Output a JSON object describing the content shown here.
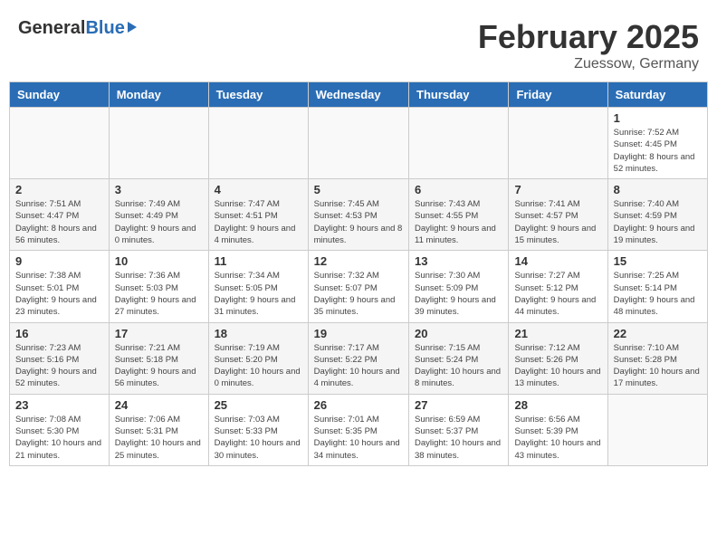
{
  "header": {
    "logo_general": "General",
    "logo_blue": "Blue",
    "month_title": "February 2025",
    "location": "Zuessow, Germany"
  },
  "days_of_week": [
    "Sunday",
    "Monday",
    "Tuesday",
    "Wednesday",
    "Thursday",
    "Friday",
    "Saturday"
  ],
  "weeks": [
    [
      {
        "day": "",
        "empty": true
      },
      {
        "day": "",
        "empty": true
      },
      {
        "day": "",
        "empty": true
      },
      {
        "day": "",
        "empty": true
      },
      {
        "day": "",
        "empty": true
      },
      {
        "day": "",
        "empty": true
      },
      {
        "day": "1",
        "sunrise": "Sunrise: 7:52 AM",
        "sunset": "Sunset: 4:45 PM",
        "daylight": "Daylight: 8 hours and 52 minutes."
      }
    ],
    [
      {
        "day": "2",
        "sunrise": "Sunrise: 7:51 AM",
        "sunset": "Sunset: 4:47 PM",
        "daylight": "Daylight: 8 hours and 56 minutes."
      },
      {
        "day": "3",
        "sunrise": "Sunrise: 7:49 AM",
        "sunset": "Sunset: 4:49 PM",
        "daylight": "Daylight: 9 hours and 0 minutes."
      },
      {
        "day": "4",
        "sunrise": "Sunrise: 7:47 AM",
        "sunset": "Sunset: 4:51 PM",
        "daylight": "Daylight: 9 hours and 4 minutes."
      },
      {
        "day": "5",
        "sunrise": "Sunrise: 7:45 AM",
        "sunset": "Sunset: 4:53 PM",
        "daylight": "Daylight: 9 hours and 8 minutes."
      },
      {
        "day": "6",
        "sunrise": "Sunrise: 7:43 AM",
        "sunset": "Sunset: 4:55 PM",
        "daylight": "Daylight: 9 hours and 11 minutes."
      },
      {
        "day": "7",
        "sunrise": "Sunrise: 7:41 AM",
        "sunset": "Sunset: 4:57 PM",
        "daylight": "Daylight: 9 hours and 15 minutes."
      },
      {
        "day": "8",
        "sunrise": "Sunrise: 7:40 AM",
        "sunset": "Sunset: 4:59 PM",
        "daylight": "Daylight: 9 hours and 19 minutes."
      }
    ],
    [
      {
        "day": "9",
        "sunrise": "Sunrise: 7:38 AM",
        "sunset": "Sunset: 5:01 PM",
        "daylight": "Daylight: 9 hours and 23 minutes."
      },
      {
        "day": "10",
        "sunrise": "Sunrise: 7:36 AM",
        "sunset": "Sunset: 5:03 PM",
        "daylight": "Daylight: 9 hours and 27 minutes."
      },
      {
        "day": "11",
        "sunrise": "Sunrise: 7:34 AM",
        "sunset": "Sunset: 5:05 PM",
        "daylight": "Daylight: 9 hours and 31 minutes."
      },
      {
        "day": "12",
        "sunrise": "Sunrise: 7:32 AM",
        "sunset": "Sunset: 5:07 PM",
        "daylight": "Daylight: 9 hours and 35 minutes."
      },
      {
        "day": "13",
        "sunrise": "Sunrise: 7:30 AM",
        "sunset": "Sunset: 5:09 PM",
        "daylight": "Daylight: 9 hours and 39 minutes."
      },
      {
        "day": "14",
        "sunrise": "Sunrise: 7:27 AM",
        "sunset": "Sunset: 5:12 PM",
        "daylight": "Daylight: 9 hours and 44 minutes."
      },
      {
        "day": "15",
        "sunrise": "Sunrise: 7:25 AM",
        "sunset": "Sunset: 5:14 PM",
        "daylight": "Daylight: 9 hours and 48 minutes."
      }
    ],
    [
      {
        "day": "16",
        "sunrise": "Sunrise: 7:23 AM",
        "sunset": "Sunset: 5:16 PM",
        "daylight": "Daylight: 9 hours and 52 minutes."
      },
      {
        "day": "17",
        "sunrise": "Sunrise: 7:21 AM",
        "sunset": "Sunset: 5:18 PM",
        "daylight": "Daylight: 9 hours and 56 minutes."
      },
      {
        "day": "18",
        "sunrise": "Sunrise: 7:19 AM",
        "sunset": "Sunset: 5:20 PM",
        "daylight": "Daylight: 10 hours and 0 minutes."
      },
      {
        "day": "19",
        "sunrise": "Sunrise: 7:17 AM",
        "sunset": "Sunset: 5:22 PM",
        "daylight": "Daylight: 10 hours and 4 minutes."
      },
      {
        "day": "20",
        "sunrise": "Sunrise: 7:15 AM",
        "sunset": "Sunset: 5:24 PM",
        "daylight": "Daylight: 10 hours and 8 minutes."
      },
      {
        "day": "21",
        "sunrise": "Sunrise: 7:12 AM",
        "sunset": "Sunset: 5:26 PM",
        "daylight": "Daylight: 10 hours and 13 minutes."
      },
      {
        "day": "22",
        "sunrise": "Sunrise: 7:10 AM",
        "sunset": "Sunset: 5:28 PM",
        "daylight": "Daylight: 10 hours and 17 minutes."
      }
    ],
    [
      {
        "day": "23",
        "sunrise": "Sunrise: 7:08 AM",
        "sunset": "Sunset: 5:30 PM",
        "daylight": "Daylight: 10 hours and 21 minutes."
      },
      {
        "day": "24",
        "sunrise": "Sunrise: 7:06 AM",
        "sunset": "Sunset: 5:31 PM",
        "daylight": "Daylight: 10 hours and 25 minutes."
      },
      {
        "day": "25",
        "sunrise": "Sunrise: 7:03 AM",
        "sunset": "Sunset: 5:33 PM",
        "daylight": "Daylight: 10 hours and 30 minutes."
      },
      {
        "day": "26",
        "sunrise": "Sunrise: 7:01 AM",
        "sunset": "Sunset: 5:35 PM",
        "daylight": "Daylight: 10 hours and 34 minutes."
      },
      {
        "day": "27",
        "sunrise": "Sunrise: 6:59 AM",
        "sunset": "Sunset: 5:37 PM",
        "daylight": "Daylight: 10 hours and 38 minutes."
      },
      {
        "day": "28",
        "sunrise": "Sunrise: 6:56 AM",
        "sunset": "Sunset: 5:39 PM",
        "daylight": "Daylight: 10 hours and 43 minutes."
      },
      {
        "day": "",
        "empty": true
      }
    ]
  ]
}
